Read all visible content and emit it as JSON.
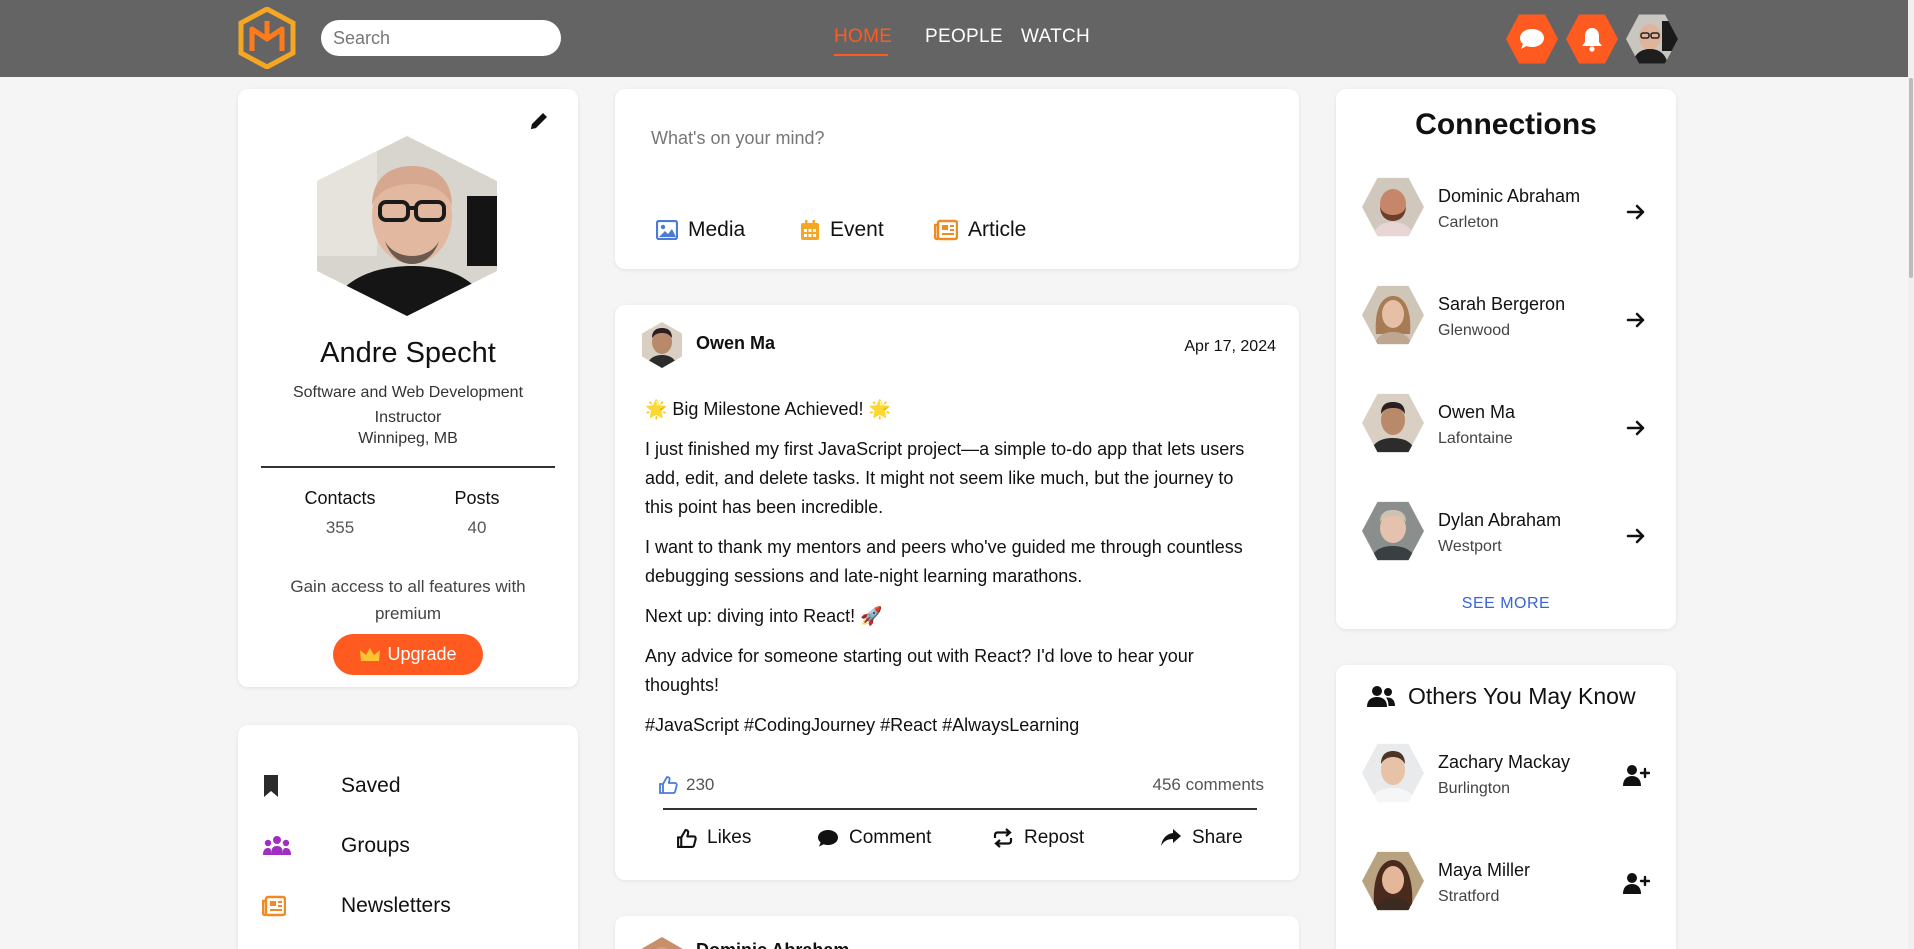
{
  "header": {
    "search_placeholder": "Search",
    "nav": [
      {
        "label": "HOME",
        "active": true
      },
      {
        "label": "PEOPLE",
        "active": false
      },
      {
        "label": "WATCH",
        "active": false
      }
    ],
    "colors": {
      "bar": "#646464",
      "accent": "#ff5a1f"
    },
    "icons": [
      "logo-icon",
      "chat-icon",
      "bell-icon",
      "user-avatar"
    ]
  },
  "profile": {
    "name": "Andre Specht",
    "title": "Software and Web Development Instructor",
    "location": "Winnipeg, MB",
    "stats": [
      {
        "label": "Contacts",
        "value": "355"
      },
      {
        "label": "Posts",
        "value": "40"
      }
    ],
    "premium_text": "Gain access to all features with premium",
    "upgrade_label": "Upgrade"
  },
  "menu": [
    {
      "label": "Saved",
      "icon": "bookmark-icon"
    },
    {
      "label": "Groups",
      "icon": "groups-icon"
    },
    {
      "label": "Newsletters",
      "icon": "newsletter-icon"
    }
  ],
  "composer": {
    "placeholder": "What's on your mind?",
    "actions": [
      {
        "label": "Media",
        "icon": "image-icon",
        "color": "#4a7bd8"
      },
      {
        "label": "Event",
        "icon": "calendar-icon",
        "color": "#f5a623"
      },
      {
        "label": "Article",
        "icon": "newspaper-icon",
        "color": "#f08a24"
      }
    ]
  },
  "post": {
    "author": "Owen Ma",
    "date": "Apr 17, 2024",
    "paragraphs": [
      "🌟 Big Milestone Achieved! 🌟",
      "I just finished my first JavaScript project—a simple to-do app that lets users add, edit, and delete tasks. It might not seem like much, but the journey to this point has been incredible.",
      "I want to thank my mentors and peers who've guided me through countless debugging sessions and late-night learning marathons.",
      "Next up: diving into React! 🚀",
      "Any advice for someone starting out with React? I'd love to hear your thoughts!",
      "#JavaScript #CodingJourney #React #AlwaysLearning"
    ],
    "likes": "230",
    "comments": "456 comments",
    "actions": [
      {
        "label": "Likes",
        "icon": "thumbs-up-icon"
      },
      {
        "label": "Comment",
        "icon": "comment-icon"
      },
      {
        "label": "Repost",
        "icon": "repost-icon"
      },
      {
        "label": "Share",
        "icon": "share-icon"
      }
    ]
  },
  "next_post": {
    "author": "Dominic Abraham"
  },
  "connections": {
    "title": "Connections",
    "items": [
      {
        "name": "Dominic Abraham",
        "location": "Carleton"
      },
      {
        "name": "Sarah Bergeron",
        "location": "Glenwood"
      },
      {
        "name": "Owen Ma",
        "location": "Lafontaine"
      },
      {
        "name": "Dylan Abraham",
        "location": "Westport"
      }
    ],
    "see_more": "SEE MORE"
  },
  "others": {
    "title": "Others You May Know",
    "items": [
      {
        "name": "Zachary Mackay",
        "location": "Burlington"
      },
      {
        "name": "Maya Miller",
        "location": "Stratford"
      }
    ]
  }
}
